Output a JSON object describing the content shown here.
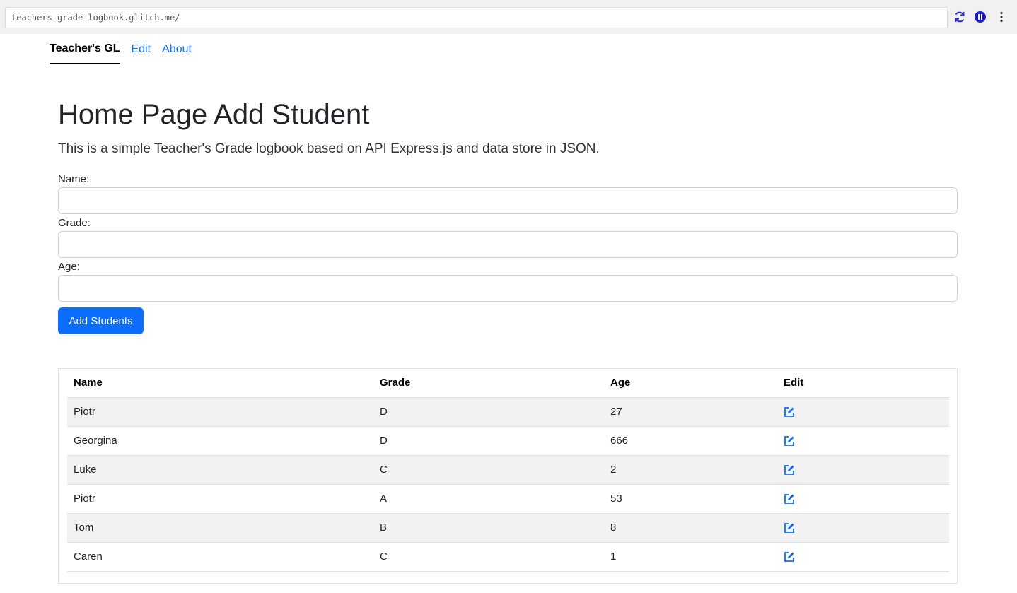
{
  "browser": {
    "url": "teachers-grade-logbook.glitch.me/",
    "icons": [
      "reload-icon",
      "pause-icon",
      "more-menu-icon"
    ]
  },
  "nav": {
    "brand": "Teacher's GL",
    "links": [
      "Edit",
      "About"
    ]
  },
  "page": {
    "title": "Home Page Add Student",
    "lead": "This is a simple Teacher's Grade logbook based on API Express.js and data store in JSON."
  },
  "form": {
    "name_label": "Name:",
    "name_value": "",
    "grade_label": "Grade:",
    "grade_value": "",
    "age_label": "Age:",
    "age_value": "",
    "submit_label": "Add Students"
  },
  "table": {
    "headers": [
      "Name",
      "Grade",
      "Age",
      "Edit"
    ],
    "rows": [
      {
        "name": "Piotr",
        "grade": "D",
        "age": "27"
      },
      {
        "name": "Georgina",
        "grade": "D",
        "age": "666"
      },
      {
        "name": "Luke",
        "grade": "C",
        "age": "2"
      },
      {
        "name": "Piotr",
        "grade": "A",
        "age": "53"
      },
      {
        "name": "Tom",
        "grade": "B",
        "age": "8"
      },
      {
        "name": "Caren",
        "grade": "C",
        "age": "1"
      }
    ]
  },
  "colors": {
    "primary": "#0d6efd",
    "icon_blue": "#1a1aff",
    "stripe": "#f2f2f2"
  }
}
